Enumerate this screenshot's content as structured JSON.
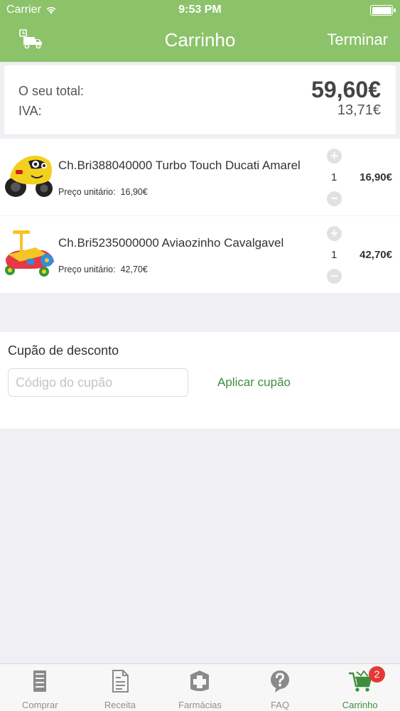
{
  "status_bar": {
    "carrier": "Carrier",
    "time": "9:53 PM",
    "icons": [
      "wifi-icon",
      "battery-icon"
    ]
  },
  "nav": {
    "title": "Carrinho",
    "right_button": "Terminar",
    "left_icon": "delivery-truck-icon"
  },
  "summary": {
    "total_label": "O seu total:",
    "total_value": "59,60€",
    "iva_label": "IVA:",
    "iva_value": "13,71€"
  },
  "items": [
    {
      "name": "Ch.Bri388040000 Turbo Touch Ducati Amarel",
      "unit_label": "Preço unitário:",
      "unit_price": "16,90€",
      "quantity": "1",
      "line_total": "16,90€",
      "image": "yellow-toy-motorbike"
    },
    {
      "name": "Ch.Bri5235000000 Aviaozinho Cavalgavel",
      "unit_label": "Preço unitário:",
      "unit_price": "42,70€",
      "quantity": "1",
      "line_total": "42,70€",
      "image": "ride-on-toy-airplane"
    }
  ],
  "stepper": {
    "plus": "+",
    "minus": "−"
  },
  "coupon": {
    "heading": "Cupão de desconto",
    "placeholder": "Código do cupão",
    "value": "",
    "apply_label": "Aplicar cupão"
  },
  "tabs": [
    {
      "label": "Comprar",
      "icon": "shop-shelf-icon",
      "active": false
    },
    {
      "label": "Receita",
      "icon": "prescription-document-icon",
      "active": false
    },
    {
      "label": "Farmácias",
      "icon": "pharmacy-cross-icon",
      "active": false
    },
    {
      "label": "FAQ",
      "icon": "question-bubble-icon",
      "active": false
    },
    {
      "label": "Carrinho",
      "icon": "cart-icon",
      "active": true
    }
  ],
  "cart_badge": "2",
  "colors": {
    "brand_green": "#8cc36a",
    "active_green": "#3e8e3e",
    "badge_red": "#e53935",
    "background": "#efeff4"
  }
}
